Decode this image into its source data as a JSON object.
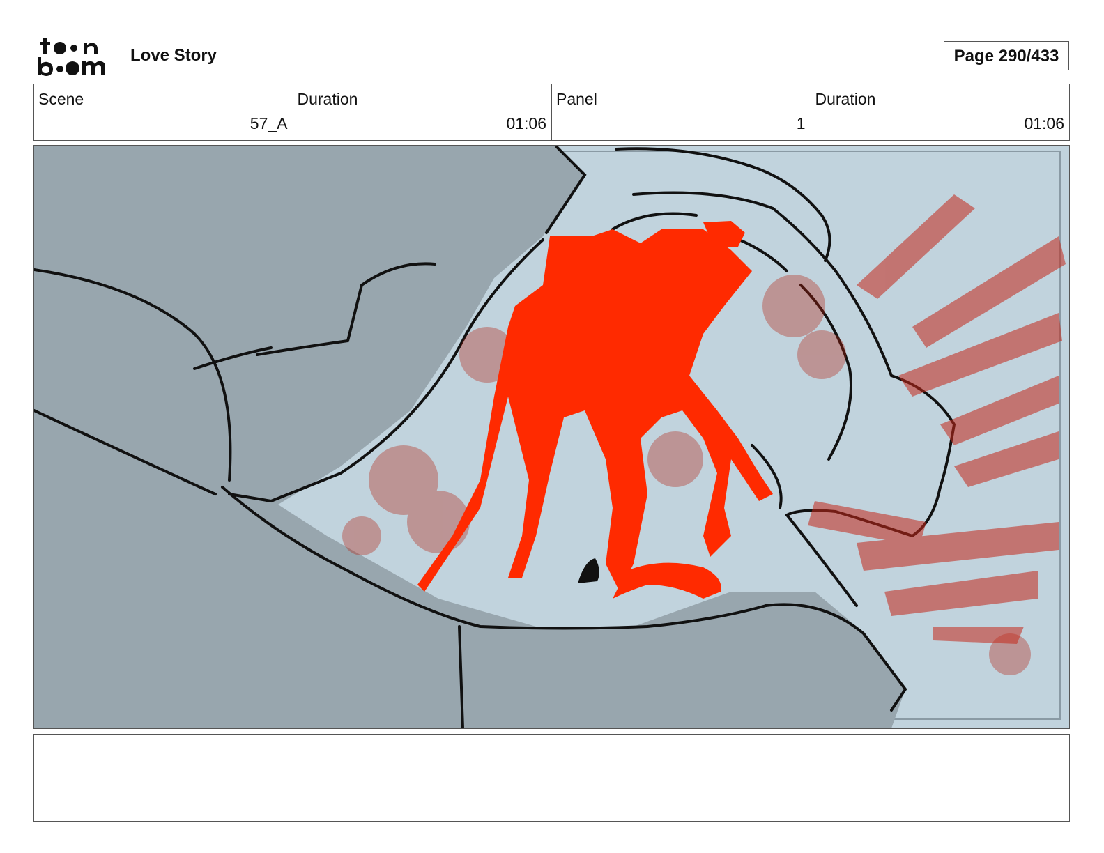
{
  "header": {
    "logo_text": "toon boom",
    "project_title": "Love Story",
    "page_indicator": "Page 290/433"
  },
  "info": {
    "scene_label": "Scene",
    "scene_value": "57_A",
    "scene_duration_label": "Duration",
    "scene_duration_value": "01:06",
    "panel_label": "Panel",
    "panel_value": "1",
    "panel_duration_label": "Duration",
    "panel_duration_value": "01:06"
  },
  "panel": {
    "colors": {
      "background": "#c1d3dd",
      "figure": "#98a6ae",
      "blood": "#ff2a00",
      "blood_dark": "#b5200f",
      "ink": "#111111"
    }
  },
  "notes": {
    "text": ""
  }
}
